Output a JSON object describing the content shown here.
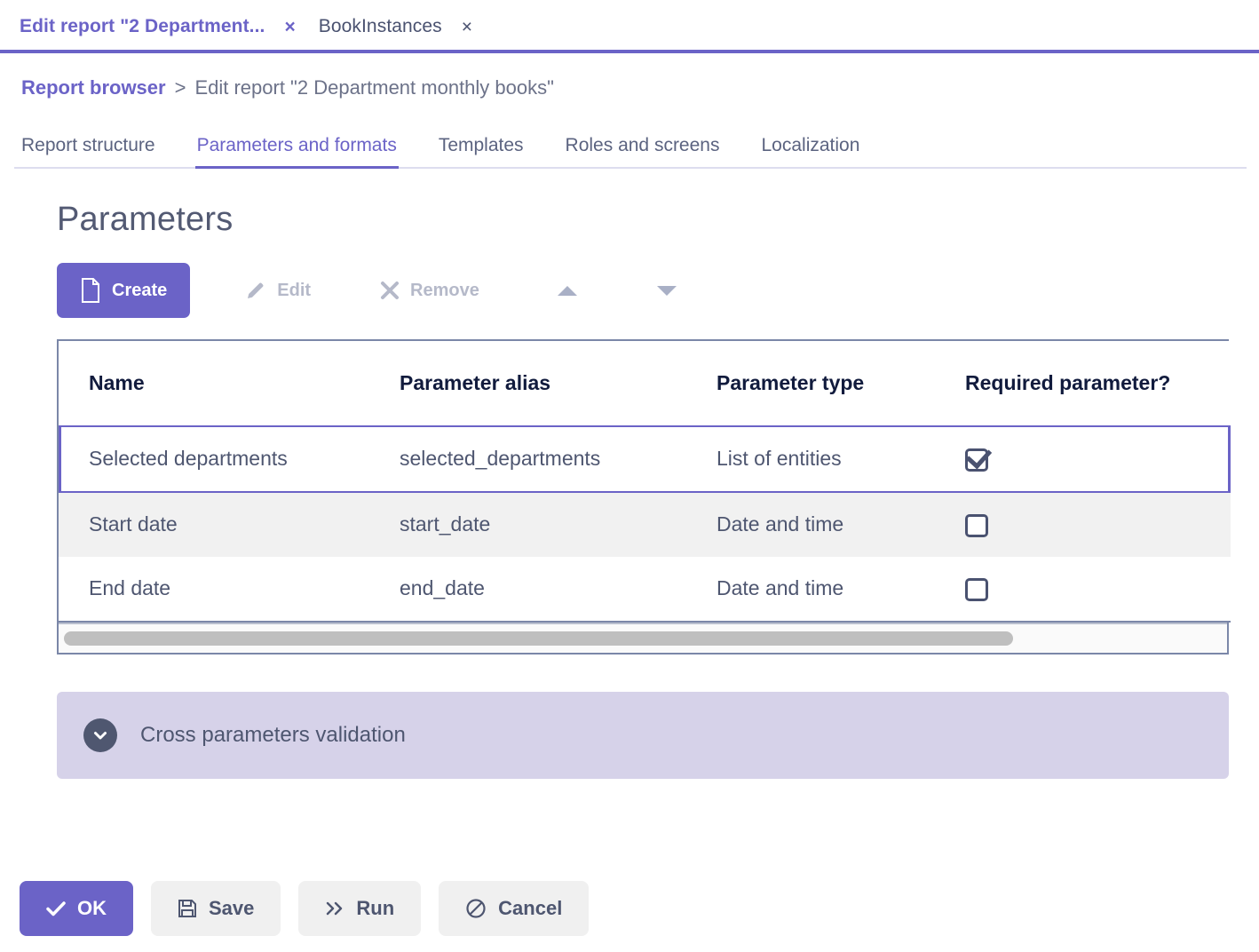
{
  "window_tabs": [
    {
      "label": "Edit report \"2 Department...",
      "close": "×",
      "active": true
    },
    {
      "label": "BookInstances",
      "close": "×",
      "active": false
    }
  ],
  "breadcrumb": {
    "root": "Report browser",
    "separator": ">",
    "current": "Edit report \"2 Department monthly books\""
  },
  "section_tabs": [
    {
      "label": "Report structure",
      "active": false
    },
    {
      "label": "Parameters and formats",
      "active": true
    },
    {
      "label": "Templates",
      "active": false
    },
    {
      "label": "Roles and screens",
      "active": false
    },
    {
      "label": "Localization",
      "active": false
    }
  ],
  "main": {
    "title": "Parameters",
    "toolbar": {
      "create": "Create",
      "edit": "Edit",
      "remove": "Remove",
      "move_up": "",
      "move_down": ""
    },
    "table": {
      "headers": [
        "Name",
        "Parameter alias",
        "Parameter type",
        "Required parameter?"
      ],
      "rows": [
        {
          "name": "Selected departments",
          "alias": "selected_departments",
          "type": "List of entities",
          "required": true,
          "selected": true
        },
        {
          "name": "Start date",
          "alias": "start_date",
          "type": "Date and time",
          "required": false,
          "selected": false
        },
        {
          "name": "End date",
          "alias": "end_date",
          "type": "Date and time",
          "required": false,
          "selected": false
        }
      ]
    },
    "validation_panel": {
      "label": "Cross parameters validation",
      "expanded": false
    }
  },
  "footer": {
    "ok": "OK",
    "save": "Save",
    "run": "Run",
    "cancel": "Cancel"
  },
  "colors": {
    "accent": "#6b63c7",
    "panel": "#d6d2e9",
    "text": "#4e5670",
    "header_text": "#111b3d",
    "disabled": "#b5b9c9",
    "table_border": "#7b87a8",
    "row_alt": "#f1f1f1"
  },
  "icons": {
    "create": "document-icon",
    "edit": "pencil-icon",
    "remove": "cross-icon",
    "move_up": "triangle-up-icon",
    "move_down": "triangle-down-icon",
    "ok": "check-icon",
    "save": "floppy-disk-icon",
    "run": "double-chevron-right-icon",
    "cancel": "no-entry-icon",
    "validation": "chevron-down-circle-icon"
  }
}
